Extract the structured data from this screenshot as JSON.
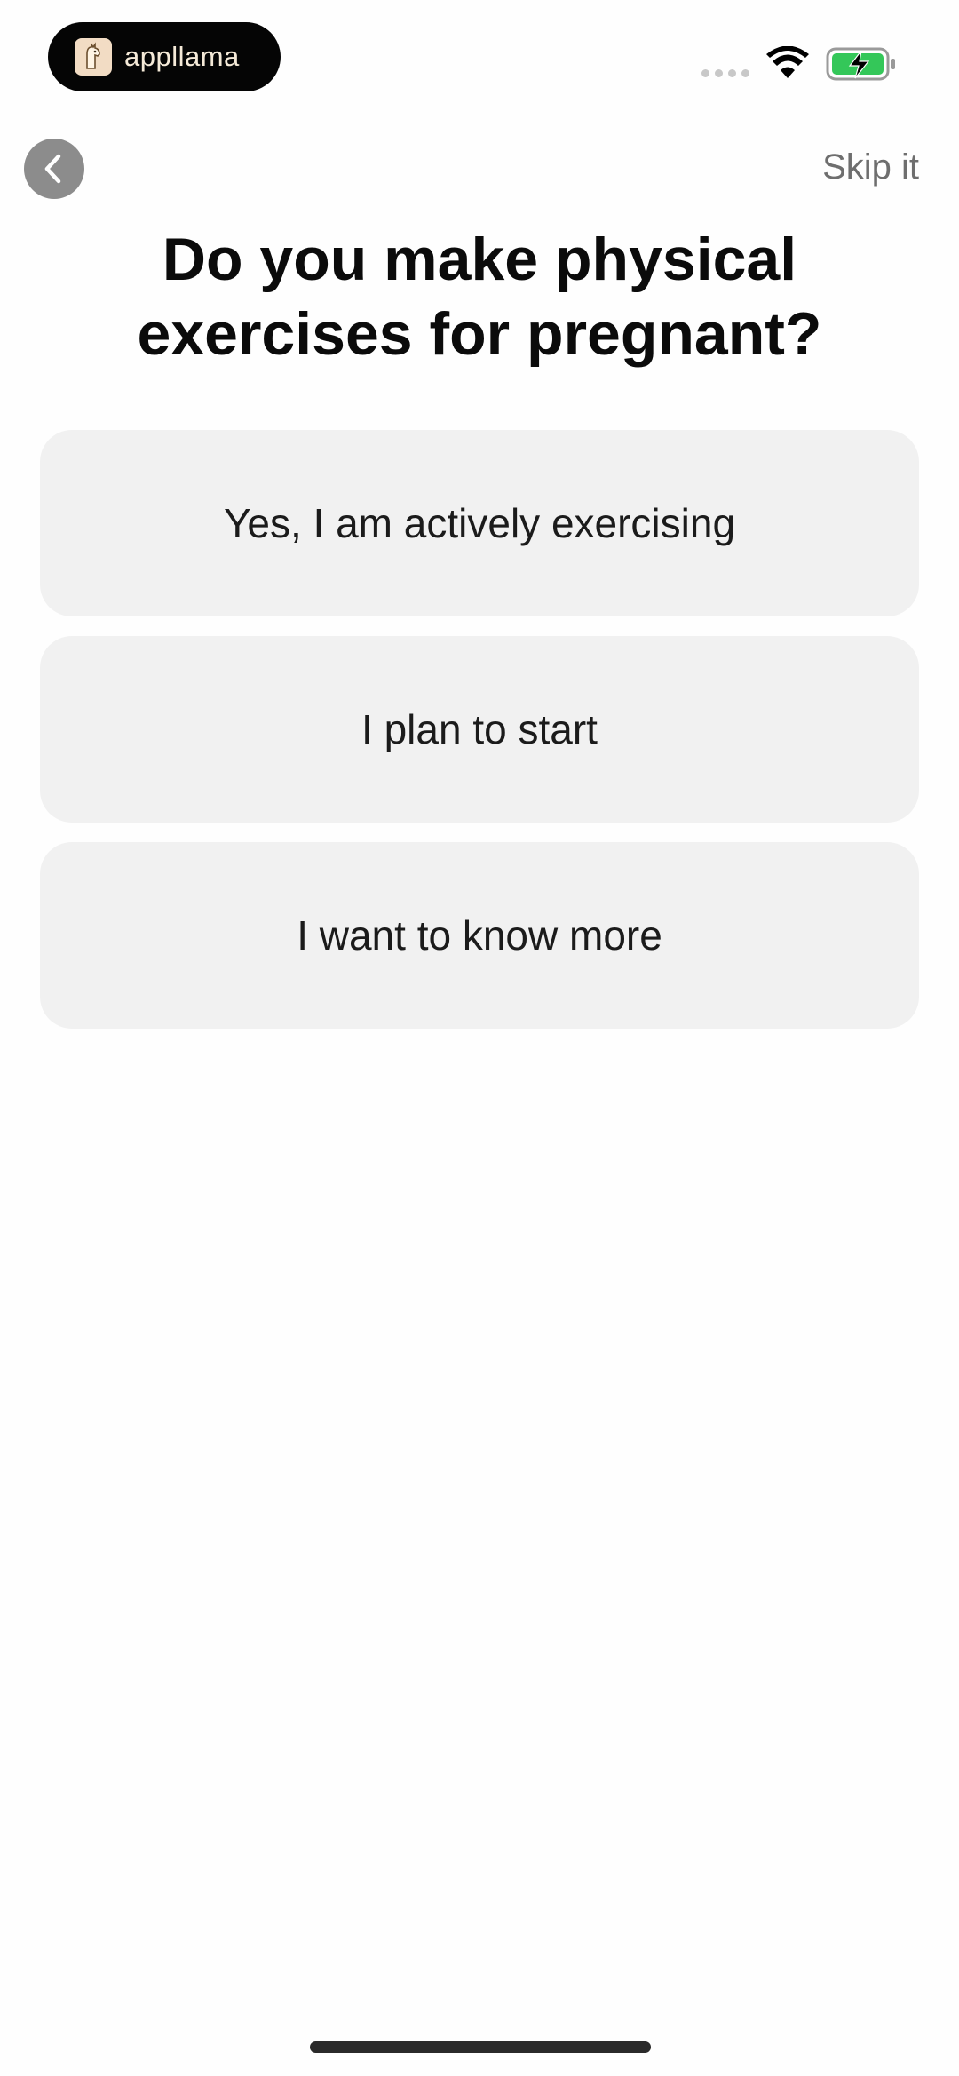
{
  "status_bar": {
    "brand_name": "appllama",
    "colors": {
      "battery_fill": "#34c759",
      "pill_bg": "#050505"
    }
  },
  "nav": {
    "back_icon": "chevron-left-icon",
    "skip_label": "Skip it"
  },
  "question": {
    "title": "Do you make physical exercises for pregnant?"
  },
  "options": [
    {
      "label": "Yes, I am actively exercising"
    },
    {
      "label": "I plan to start"
    },
    {
      "label": "I want to know more"
    }
  ]
}
